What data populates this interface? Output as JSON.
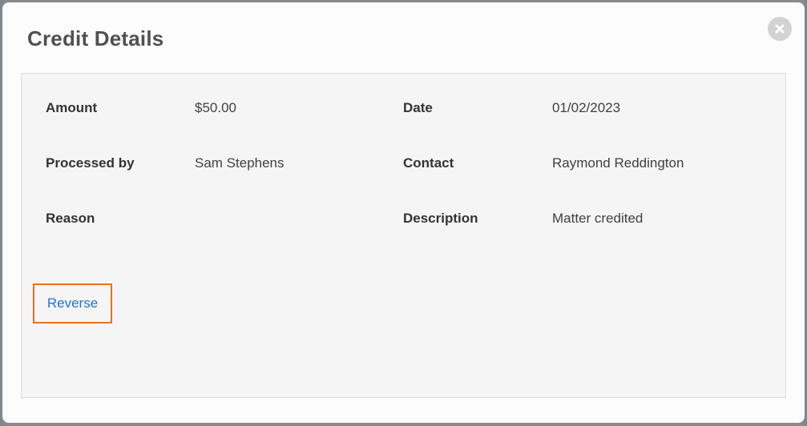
{
  "modal": {
    "title": "Credit Details",
    "close_icon": "close-icon"
  },
  "details": {
    "amount_label": "Amount",
    "amount_value": "$50.00",
    "date_label": "Date",
    "date_value": "01/02/2023",
    "processed_by_label": "Processed by",
    "processed_by_value": "Sam Stephens",
    "contact_label": "Contact",
    "contact_value": "Raymond Reddington",
    "reason_label": "Reason",
    "reason_value": "",
    "description_label": "Description",
    "description_value": "Matter credited"
  },
  "actions": {
    "reverse_label": "Reverse"
  },
  "colors": {
    "link": "#1f74d6",
    "highlight": "#e8711f",
    "panel_bg": "#f5f5f5"
  }
}
